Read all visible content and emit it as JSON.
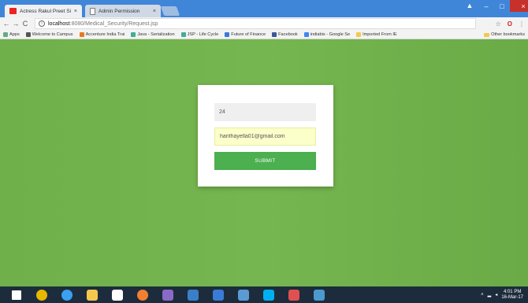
{
  "browser": {
    "tabs": [
      {
        "label": "Actress Rakul Preet Sing",
        "close": "×",
        "favicon": "youtube-icon"
      },
      {
        "label": "Admin Permission",
        "close": "×",
        "favicon": "document-icon"
      }
    ],
    "nav": {
      "back": "←",
      "forward": "→",
      "reload": "C",
      "info": "i"
    },
    "url": {
      "host": "localhost",
      "path": ":8080/Medical_Security/Request.jsp"
    },
    "right_icons": {
      "star": "☆",
      "opera": "O",
      "menu": "⋮"
    },
    "window_controls": {
      "minimize": "–",
      "maximize": "□",
      "close": "×",
      "user": "▲"
    }
  },
  "bookmarks": [
    {
      "label": "Apps",
      "color": "#6a8"
    },
    {
      "label": "Welcome to Campus",
      "color": "#555"
    },
    {
      "label": "Accenture India Trai",
      "color": "#e57a1e"
    },
    {
      "label": "Java - Serialization",
      "color": "#4a9"
    },
    {
      "label": "JSP - Life Cycle",
      "color": "#4a9"
    },
    {
      "label": "Future of Finance",
      "color": "#3a7bd5"
    },
    {
      "label": "Facebook",
      "color": "#3b5998"
    },
    {
      "label": "indiabix - Google Se",
      "color": "#4285f4"
    },
    {
      "label": "Imported From IE",
      "color": "#f2c94c"
    }
  ],
  "other_bookmarks": "Other bookmarks",
  "form": {
    "age_value": "24",
    "email_value": "harithayella01@gmail.com",
    "submit_label": "SUBMIT"
  },
  "taskbar": {
    "apps": [
      {
        "name": "windows-start-icon",
        "color": "#ffffff"
      },
      {
        "name": "chrome-icon",
        "color": "#e6b800"
      },
      {
        "name": "edge-icon",
        "color": "#3aa0f0"
      },
      {
        "name": "file-explorer-icon",
        "color": "#f2c94c"
      },
      {
        "name": "store-icon",
        "color": "#ffffff"
      },
      {
        "name": "firefox-icon",
        "color": "#f08030"
      },
      {
        "name": "eclipse-icon",
        "color": "#8a6ac8"
      },
      {
        "name": "notepad-icon",
        "color": "#3a80c8"
      },
      {
        "name": "virtualbox-icon",
        "color": "#3a7bd5"
      },
      {
        "name": "calendar-icon",
        "color": "#5b9bd5"
      },
      {
        "name": "skype-icon",
        "color": "#00aff0"
      },
      {
        "name": "media-icon",
        "color": "#e05050"
      },
      {
        "name": "chrome-taskbar-icon",
        "color": "#4a9ad0"
      }
    ],
    "time": "4:01 PM",
    "date": "16-Mar-17"
  },
  "colors": {
    "page_background": "#6fb04a",
    "submit_button": "#4caf50",
    "email_autofill": "#fbffc9",
    "tab_strip": "#3f86d9"
  }
}
